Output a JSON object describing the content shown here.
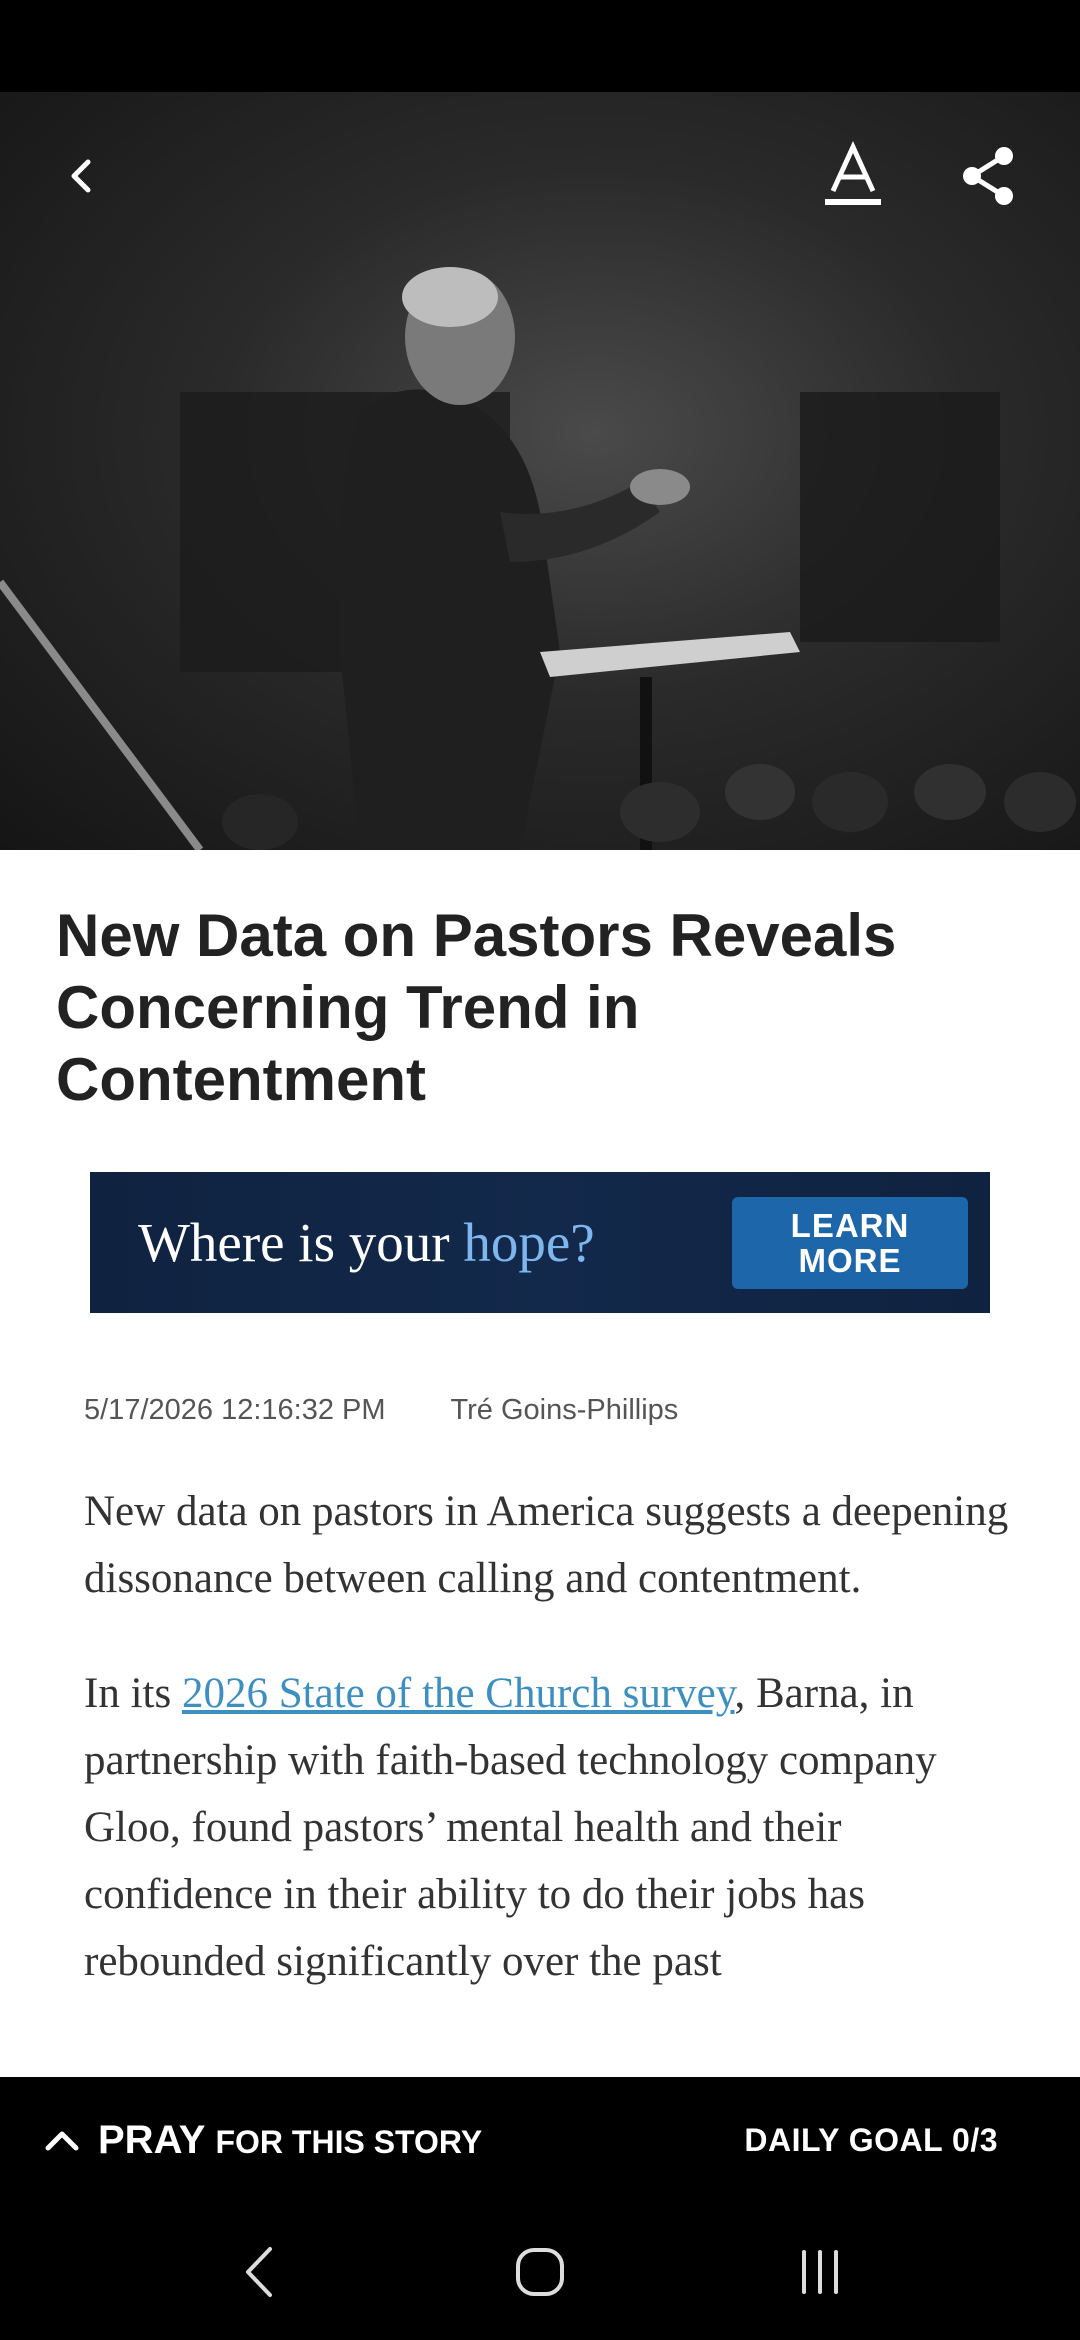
{
  "article": {
    "title": "New Data on Pastors Reveals Concerning Trend in Contentment",
    "date": "5/17/2026 12:16:32 PM",
    "author": "Tré Goins-Phillips",
    "paragraph1": "New data on pastors in America suggests a deepening dissonance between calling and contentment.",
    "paragraph2_before_link": "In its ",
    "paragraph2_link": "2026 State of the Church survey",
    "paragraph2_after_link": ", Barna, in partnership with faith-based technology company Gloo, found pastors’ mental health and their confidence in their ability to do their jobs has rebounded significantly over the past"
  },
  "ad": {
    "text_main": "Where is your ",
    "text_accent": "hope?",
    "cta_line1": "LEARN",
    "cta_line2": "MORE"
  },
  "toolbar": {
    "back_icon": "chevron-left-icon",
    "font_icon": "font-size-icon",
    "share_icon": "share-icon"
  },
  "pray_bar": {
    "pray": "PRAY",
    "rest": "FOR THIS STORY",
    "goal": "DAILY GOAL 0/3"
  },
  "colors": {
    "link": "#3d8fc2",
    "ad_background": "#13294b",
    "ad_accent": "#7db7ee",
    "ad_button": "#1e66aa"
  }
}
